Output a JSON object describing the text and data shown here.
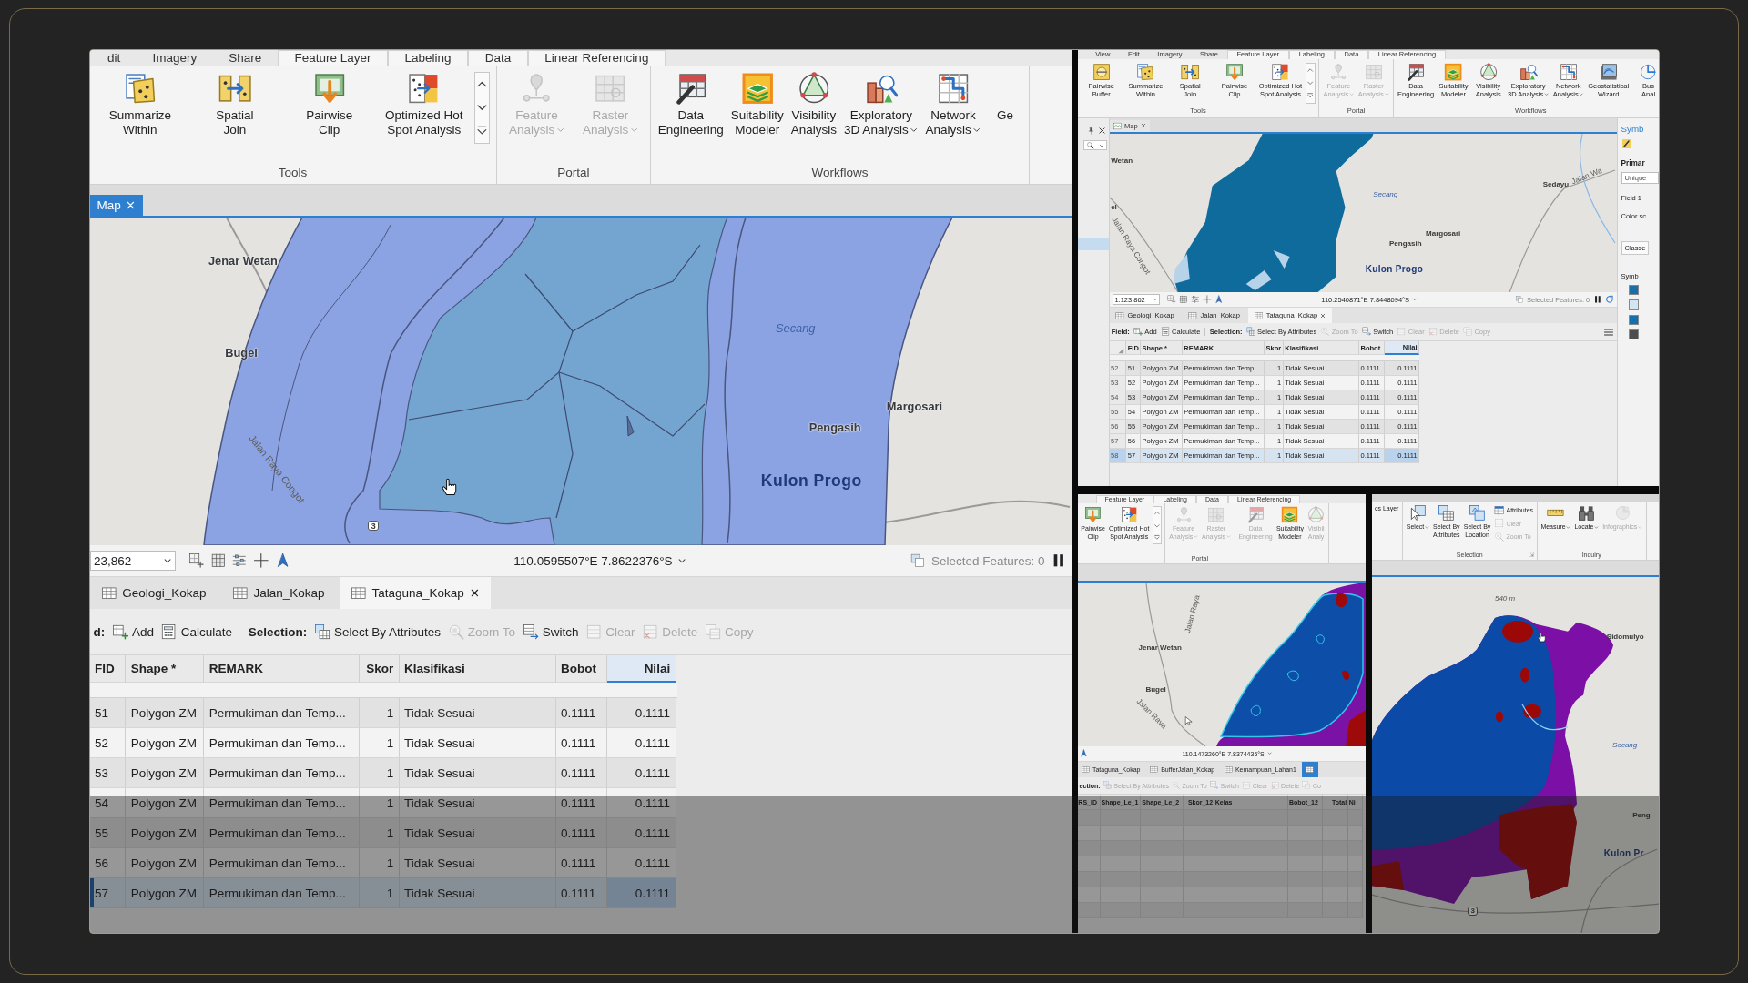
{
  "panels": [
    {
      "ribbon_tabs": [
        {
          "label": "dit",
          "contextual": false
        },
        {
          "label": "Imagery",
          "contextual": false
        },
        {
          "label": "Share",
          "contextual": false
        },
        {
          "label": "Feature Layer",
          "contextual": true
        },
        {
          "label": "Labeling",
          "contextual": true
        },
        {
          "label": "Data",
          "contextual": true
        },
        {
          "label": "Linear Referencing",
          "contextual": true
        }
      ],
      "ribbon_groups": [
        {
          "label": "Tools",
          "tools": [
            {
              "kind": "large",
              "label": "Summarize\nWithin",
              "disabled": false,
              "dropdown": false
            },
            {
              "kind": "large",
              "label": "Spatial\nJoin",
              "disabled": false,
              "dropdown": false
            },
            {
              "kind": "large",
              "label": "Pairwise\nClip",
              "disabled": false,
              "dropdown": false
            },
            {
              "kind": "large",
              "label": "Optimized Hot\nSpot Analysis",
              "disabled": false,
              "dropdown": false
            },
            {
              "kind": "scroller"
            }
          ]
        },
        {
          "label": "Portal",
          "tools": [
            {
              "kind": "large",
              "label": "Feature\nAnalysis",
              "disabled": true,
              "dropdown": true
            },
            {
              "kind": "large",
              "label": "Raster\nAnalysis",
              "disabled": true,
              "dropdown": true
            }
          ]
        },
        {
          "label": "Workflows",
          "tools": [
            {
              "kind": "large",
              "label": "Data\nEngineering",
              "disabled": false,
              "dropdown": false
            },
            {
              "kind": "large",
              "label": "Suitability\nModeler",
              "disabled": false,
              "dropdown": false
            },
            {
              "kind": "large",
              "label": "Visibility\nAnalysis",
              "disabled": false,
              "dropdown": false
            },
            {
              "kind": "large",
              "label": "Exploratory\n3D Analysis",
              "disabled": false,
              "dropdown": true
            },
            {
              "kind": "large",
              "label": "Network\nAnalysis",
              "disabled": false,
              "dropdown": true
            },
            {
              "kind": "large",
              "label": "Ge",
              "disabled": false,
              "dropdown": false
            }
          ]
        }
      ],
      "map_tabs": [
        {
          "label": "Map",
          "selected": true
        }
      ],
      "map": {
        "labels": [
          {
            "text": "Jenar Wetan",
            "kind": "place"
          },
          {
            "text": "Bugel",
            "kind": "place"
          },
          {
            "text": "Jalan Raya Congot",
            "kind": "road"
          },
          {
            "text": "Secang",
            "kind": "water"
          },
          {
            "text": "Margosari",
            "kind": "place"
          },
          {
            "text": "Pengasih",
            "kind": "place"
          },
          {
            "text": "Kulon Progo",
            "kind": "region"
          },
          {
            "text": "3",
            "kind": "shield"
          }
        ]
      },
      "status_bar": {
        "scale": "23,862",
        "coordinates": "110.0595507°E 7.8622376°S",
        "selected_features": "Selected Features: 0"
      },
      "table_tabs": [
        {
          "label": "Geologi_Kokap",
          "selected": false
        },
        {
          "label": "Jalan_Kokap",
          "selected": false
        },
        {
          "label": "Tataguna_Kokap",
          "selected": true
        }
      ],
      "table_toolbar": [
        {
          "kind": "label",
          "label": "d:"
        },
        {
          "kind": "button",
          "label": "Add",
          "disabled": false
        },
        {
          "kind": "button",
          "label": "Calculate",
          "disabled": false
        },
        {
          "kind": "label",
          "label": "Selection:"
        },
        {
          "kind": "button",
          "label": "Select By Attributes",
          "disabled": false
        },
        {
          "kind": "button",
          "label": "Zoom To",
          "disabled": true
        },
        {
          "kind": "button",
          "label": "Switch",
          "disabled": false
        },
        {
          "kind": "button",
          "label": "Clear",
          "disabled": true
        },
        {
          "kind": "button",
          "label": "Delete",
          "disabled": true
        },
        {
          "kind": "button",
          "label": "Copy",
          "disabled": true
        }
      ],
      "table": {
        "columns": [
          {
            "label": "FID",
            "selected": false
          },
          {
            "label": "Shape *",
            "selected": false
          },
          {
            "label": "REMARK",
            "selected": false
          },
          {
            "label": "Skor",
            "selected": false
          },
          {
            "label": "Klasifikasi",
            "selected": false
          },
          {
            "label": "Bobot",
            "selected": false
          },
          {
            "label": "Nilai",
            "selected": true
          }
        ],
        "rows": [
          {
            "cells": [
              "51",
              "Polygon ZM",
              "Permukiman dan Temp...",
              "1",
              "Tidak Sesuai",
              "0.1111",
              "0.1111"
            ],
            "selected": false
          },
          {
            "cells": [
              "52",
              "Polygon ZM",
              "Permukiman dan Temp...",
              "1",
              "Tidak Sesuai",
              "0.1111",
              "0.1111"
            ],
            "selected": false
          },
          {
            "cells": [
              "53",
              "Polygon ZM",
              "Permukiman dan Temp...",
              "1",
              "Tidak Sesuai",
              "0.1111",
              "0.1111"
            ],
            "selected": false
          },
          {
            "cells": [
              "54",
              "Polygon ZM",
              "Permukiman dan Temp...",
              "1",
              "Tidak Sesuai",
              "0.1111",
              "0.1111"
            ],
            "selected": false
          },
          {
            "cells": [
              "55",
              "Polygon ZM",
              "Permukiman dan Temp...",
              "1",
              "Tidak Sesuai",
              "0.1111",
              "0.1111"
            ],
            "selected": false
          },
          {
            "cells": [
              "56",
              "Polygon ZM",
              "Permukiman dan Temp...",
              "1",
              "Tidak Sesuai",
              "0.1111",
              "0.1111"
            ],
            "selected": false
          },
          {
            "cells": [
              "57",
              "Polygon ZM",
              "Permukiman dan Temp...",
              "1",
              "Tidak Sesuai",
              "0.1111",
              "0.1111"
            ],
            "selected": true
          }
        ]
      }
    },
    {
      "ribbon_tabs": [
        {
          "label": "View",
          "contextual": false
        },
        {
          "label": "Edit",
          "contextual": false
        },
        {
          "label": "Imagery",
          "contextual": false
        },
        {
          "label": "Share",
          "contextual": false
        },
        {
          "label": "Feature Layer",
          "contextual": true
        },
        {
          "label": "Labeling",
          "contextual": true
        },
        {
          "label": "Data",
          "contextual": true
        },
        {
          "label": "Linear Referencing",
          "contextual": true
        }
      ],
      "ribbon_groups": [
        {
          "label": "Tools",
          "tools": [
            {
              "kind": "large",
              "label": "Pairwise\nBuffer",
              "disabled": false,
              "dropdown": false
            },
            {
              "kind": "large",
              "label": "Summarize\nWithin",
              "disabled": false,
              "dropdown": false
            },
            {
              "kind": "large",
              "label": "Spatial\nJoin",
              "disabled": false,
              "dropdown": false
            },
            {
              "kind": "large",
              "label": "Pairwise\nClip",
              "disabled": false,
              "dropdown": false
            },
            {
              "kind": "large",
              "label": "Optimized Hot\nSpot Analysis",
              "disabled": false,
              "dropdown": false
            },
            {
              "kind": "scroller"
            }
          ]
        },
        {
          "label": "Portal",
          "tools": [
            {
              "kind": "large",
              "label": "Feature\nAnalysis",
              "disabled": true,
              "dropdown": true
            },
            {
              "kind": "large",
              "label": "Raster\nAnalysis",
              "disabled": true,
              "dropdown": true
            }
          ]
        },
        {
          "label": "Workflows",
          "tools": [
            {
              "kind": "large",
              "label": "Data\nEngineering",
              "disabled": false,
              "dropdown": false
            },
            {
              "kind": "large",
              "label": "Suitability\nModeler",
              "disabled": false,
              "dropdown": false
            },
            {
              "kind": "large",
              "label": "Visibility\nAnalysis",
              "disabled": false,
              "dropdown": false
            },
            {
              "kind": "large",
              "label": "Exploratory\n3D Analysis",
              "disabled": false,
              "dropdown": true
            },
            {
              "kind": "large",
              "label": "Network\nAnalysis",
              "disabled": false,
              "dropdown": true
            },
            {
              "kind": "large",
              "label": "Geostatistical\nWizard",
              "disabled": false,
              "dropdown": false
            },
            {
              "kind": "large",
              "label": "Bus\nAnal",
              "disabled": false,
              "dropdown": false
            }
          ]
        }
      ],
      "left_pane": {
        "rows": [
          {
            "selected": true
          }
        ]
      },
      "map_tabs": [
        {
          "label": "Map",
          "selected": false
        }
      ],
      "map": {
        "labels": [
          {
            "text": "Wetan",
            "kind": "place"
          },
          {
            "text": "el",
            "kind": "place"
          },
          {
            "text": "Jalan Raya Congot",
            "kind": "road"
          },
          {
            "text": "Secang",
            "kind": "water"
          },
          {
            "text": "Sedayu",
            "kind": "place"
          },
          {
            "text": "Jalan Wa",
            "kind": "road"
          },
          {
            "text": "Margosari",
            "kind": "place"
          },
          {
            "text": "Pengasih",
            "kind": "place"
          },
          {
            "text": "Kulon Progo",
            "kind": "region"
          }
        ]
      },
      "status_bar": {
        "scale": "1:123,862",
        "coordinates": "110.2540871°E 7.8448094°S",
        "selected_features": "Selected Features: 0"
      },
      "table_tabs": [
        {
          "label": "Geologi_Kokap",
          "selected": false
        },
        {
          "label": "Jalan_Kokap",
          "selected": false
        },
        {
          "label": "Tataguna_Kokap",
          "selected": true
        }
      ],
      "table_toolbar": [
        {
          "kind": "label",
          "label": "Field:"
        },
        {
          "kind": "button",
          "label": "Add",
          "disabled": false
        },
        {
          "kind": "button",
          "label": "Calculate",
          "disabled": false
        },
        {
          "kind": "label",
          "label": "Selection:"
        },
        {
          "kind": "button",
          "label": "Select By Attributes",
          "disabled": false
        },
        {
          "kind": "button",
          "label": "Zoom To",
          "disabled": true
        },
        {
          "kind": "button",
          "label": "Switch",
          "disabled": false
        },
        {
          "kind": "button",
          "label": "Clear",
          "disabled": true
        },
        {
          "kind": "button",
          "label": "Delete",
          "disabled": true
        },
        {
          "kind": "button",
          "label": "Copy",
          "disabled": true
        }
      ],
      "table": {
        "columns": [
          {
            "label": "FID",
            "selected": false
          },
          {
            "label": "Shape *",
            "selected": false
          },
          {
            "label": "REMARK",
            "selected": false
          },
          {
            "label": "Skor",
            "selected": false
          },
          {
            "label": "Klasifikasi",
            "selected": false
          },
          {
            "label": "Bobot",
            "selected": false
          },
          {
            "label": "Nilai",
            "selected": true
          }
        ],
        "rows": [
          {
            "row_number": "52",
            "cells": [
              "51",
              "Polygon ZM",
              "Permukiman dan Temp...",
              "1",
              "Tidak Sesuai",
              "0.1111",
              "0.1111"
            ],
            "selected": false
          },
          {
            "row_number": "53",
            "cells": [
              "52",
              "Polygon ZM",
              "Permukiman dan Temp...",
              "1",
              "Tidak Sesuai",
              "0.1111",
              "0.1111"
            ],
            "selected": false
          },
          {
            "row_number": "54",
            "cells": [
              "53",
              "Polygon ZM",
              "Permukiman dan Temp...",
              "1",
              "Tidak Sesuai",
              "0.1111",
              "0.1111"
            ],
            "selected": false
          },
          {
            "row_number": "55",
            "cells": [
              "54",
              "Polygon ZM",
              "Permukiman dan Temp...",
              "1",
              "Tidak Sesuai",
              "0.1111",
              "0.1111"
            ],
            "selected": false
          },
          {
            "row_number": "56",
            "cells": [
              "55",
              "Polygon ZM",
              "Permukiman dan Temp...",
              "1",
              "Tidak Sesuai",
              "0.1111",
              "0.1111"
            ],
            "selected": false
          },
          {
            "row_number": "57",
            "cells": [
              "56",
              "Polygon ZM",
              "Permukiman dan Temp...",
              "1",
              "Tidak Sesuai",
              "0.1111",
              "0.1111"
            ],
            "selected": false
          },
          {
            "row_number": "58",
            "cells": [
              "57",
              "Polygon ZM",
              "Permukiman dan Temp...",
              "1",
              "Tidak Sesuai",
              "0.1111",
              "0.1111"
            ],
            "selected": true
          }
        ]
      },
      "right_pane": {
        "title": "Symb",
        "items": [
          {
            "kind": "heading",
            "text": "Primar"
          },
          {
            "kind": "dropdown",
            "text": "Unique"
          },
          {
            "kind": "label",
            "text": "Field 1"
          },
          {
            "kind": "label",
            "text": "Color sc"
          },
          {
            "kind": "tab",
            "text": "Classe"
          },
          {
            "kind": "header",
            "text": "Symb"
          }
        ],
        "swatches": [
          {
            "color": "#1a6fa6"
          },
          {
            "color": "#d3e5f3"
          },
          {
            "color": "#1570b0"
          },
          {
            "color": "#4d4d4d"
          }
        ]
      }
    },
    {
      "ribbon_tabs": [
        {
          "label": "Feature Layer",
          "contextual": true
        },
        {
          "label": "Labeling",
          "contextual": true
        },
        {
          "label": "Data",
          "contextual": true
        },
        {
          "label": "Linear Referencing",
          "contextual": true
        }
      ],
      "ribbon_groups": [
        {
          "tools": [
            {
              "kind": "large",
              "label": "Pairwise\nClip",
              "disabled": false,
              "dropdown": false
            },
            {
              "kind": "large",
              "label": "Optimized Hot\nSpot Analysis",
              "disabled": false,
              "dropdown": false
            },
            {
              "kind": "scroller"
            }
          ]
        },
        {
          "label": "Portal",
          "tools": [
            {
              "kind": "large",
              "label": "Feature\nAnalysis",
              "disabled": true,
              "dropdown": true
            },
            {
              "kind": "large",
              "label": "Raster\nAnalysis",
              "disabled": true,
              "dropdown": true
            }
          ]
        },
        {
          "tools": [
            {
              "kind": "large",
              "label": "Data\nEngineering",
              "disabled": true,
              "dropdown": false
            },
            {
              "kind": "large",
              "label": "Suitability\nModeler",
              "disabled": false,
              "dropdown": false
            },
            {
              "kind": "large",
              "label": "Visibil\nAnaly",
              "disabled": true,
              "dropdown": false
            }
          ]
        }
      ],
      "map": {
        "labels": [
          {
            "text": "Jenar Wetan",
            "kind": "place"
          },
          {
            "text": "Bugel",
            "kind": "place"
          },
          {
            "text": "Jalan Raya",
            "kind": "road"
          },
          {
            "text": "Jalan Raya",
            "kind": "road"
          }
        ]
      },
      "status_bar": {
        "coordinates": "110.1473260°E 7.8374435°S"
      },
      "table_tabs": [
        {
          "label": "Tataguna_Kokap",
          "selected": false
        },
        {
          "label": "BufferJalan_Kokap",
          "selected": false
        },
        {
          "label": "Kemampuan_Lahan1",
          "selected": false
        },
        {
          "selected": true
        }
      ],
      "table_toolbar": [
        {
          "kind": "label",
          "label": "ection:"
        },
        {
          "kind": "button",
          "label": "Select By Attributes",
          "disabled": true
        },
        {
          "kind": "button",
          "label": "Zoom To",
          "disabled": true
        },
        {
          "kind": "button",
          "label": "Switch",
          "disabled": true
        },
        {
          "kind": "button",
          "label": "Clear",
          "disabled": true
        },
        {
          "kind": "button",
          "label": "Delete",
          "disabled": true
        },
        {
          "kind": "button",
          "label": "Co",
          "disabled": true
        }
      ],
      "table": {
        "columns": [
          {
            "label": "RS_ID",
            "selected": false
          },
          {
            "label": "Shape_Le_1",
            "selected": false
          },
          {
            "label": "Shape_Le_2",
            "selected": false
          },
          {
            "label": "Skor_12",
            "selected": false
          },
          {
            "label": "Kelas",
            "selected": false
          },
          {
            "label": "Bobot_12",
            "selected": false
          },
          {
            "label": "Total",
            "selected": false
          },
          {
            "label": "Ni",
            "selected": false
          }
        ]
      }
    },
    {
      "ribbon_groups": [
        {
          "tools": [
            {
              "kind": "small",
              "label": "cs Layer",
              "disabled": false,
              "dropdown": false
            }
          ]
        },
        {
          "label": "Selection",
          "launcher": true,
          "tools": [
            {
              "kind": "large",
              "label": "Select",
              "disabled": false,
              "dropdown": true
            },
            {
              "kind": "large",
              "label": "Select By\nAttributes",
              "disabled": false,
              "dropdown": false
            },
            {
              "kind": "large",
              "label": "Select By\nLocation",
              "disabled": false,
              "dropdown": false
            },
            {
              "kind": "small",
              "label": "Attributes",
              "disabled": false,
              "dropdown": false
            },
            {
              "kind": "small",
              "label": "Clear",
              "disabled": true,
              "dropdown": false
            },
            {
              "kind": "small",
              "label": "Zoom To",
              "disabled": true,
              "dropdown": false
            }
          ]
        },
        {
          "label": "Inquiry",
          "launcher": false,
          "tools": [
            {
              "kind": "large",
              "label": "Measure",
              "disabled": false,
              "dropdown": true
            },
            {
              "kind": "large",
              "label": "Locate",
              "disabled": false,
              "dropdown": true
            },
            {
              "kind": "large",
              "label": "Infographics",
              "disabled": true,
              "dropdown": true
            }
          ]
        }
      ],
      "map": {
        "labels": [
          {
            "text": "540 m",
            "kind": "spot"
          },
          {
            "text": "Sidomulyo",
            "kind": "place"
          },
          {
            "text": "Secang",
            "kind": "water"
          },
          {
            "text": "Peng",
            "kind": "place"
          },
          {
            "text": "Kulon Pr",
            "kind": "region"
          },
          {
            "text": "3",
            "kind": "shield"
          }
        ]
      }
    }
  ]
}
